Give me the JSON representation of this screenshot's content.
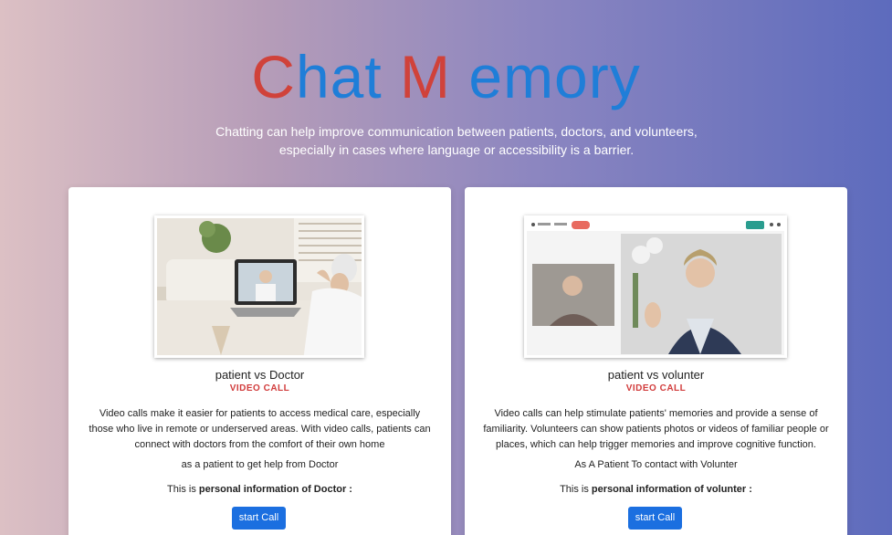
{
  "hero": {
    "logo_part1": "Chat",
    "logo_part2": "M",
    "logo_part3": "emory",
    "subtitle": "Chatting can help improve communication between patients, doctors, and volunteers, especially in cases where language or accessibility is a barrier."
  },
  "cards": [
    {
      "title": "patient vs Doctor",
      "tag": "VIDEO CALL",
      "description": "Video calls make it easier for patients to access medical care, especially those who live in remote or underserved areas. With video calls, patients can connect with doctors from the comfort of their own home",
      "role": "as a patient to get help from Doctor",
      "info_prefix": "This is ",
      "info_bold": "personal information of Doctor :",
      "button": "start Call"
    },
    {
      "title": "patient vs volunter",
      "tag": "VIDEO CALL",
      "description": "Video calls can help stimulate patients' memories and provide a sense of familiarity. Volunteers can show patients photos or videos of familiar people or places, which can help trigger memories and improve cognitive function.",
      "role": "As A Patient To contact with Volunter",
      "info_prefix": "This is ",
      "info_bold": "personal information of volunter :",
      "button": "start Call"
    }
  ],
  "colors": {
    "logo_red": "#d0423a",
    "logo_blue": "#1f7ed8",
    "tag_red": "#d13b3b",
    "button_blue": "#1b6fe0"
  }
}
